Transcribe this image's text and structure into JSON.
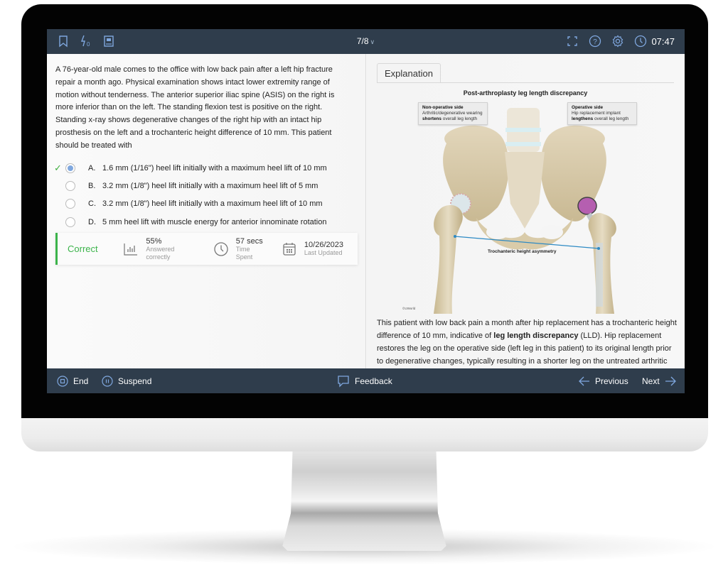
{
  "topbar": {
    "question_counter": "7/8",
    "timer": "07:47",
    "left_icons": [
      "bookmark-icon",
      "lab-values-icon",
      "notes-icon"
    ],
    "right_icons": [
      "fullscreen-icon",
      "help-icon",
      "settings-icon",
      "clock-icon"
    ]
  },
  "question": {
    "stem": "A 76-year-old male comes to the office with low back pain after a left hip fracture repair a month ago.  Physical examination shows intact lower extremity range of motion without tenderness.  The anterior superior iliac spine (ASIS) on the right is more inferior than on the left.  The standing flexion test is positive on the right.  Standing x-ray shows degenerative changes of the right hip with an intact hip prosthesis on the left and a trochanteric height difference of 10 mm.  This patient should be treated with",
    "options": [
      {
        "letter": "A.",
        "text": "1.6 mm (1/16\") heel lift initially with a maximum heel lift of 10 mm",
        "selected": true,
        "correct_mark": "✓"
      },
      {
        "letter": "B.",
        "text": "3.2 mm (1/8\") heel lift initially with a maximum heel lift of 5 mm",
        "selected": false,
        "correct_mark": ""
      },
      {
        "letter": "C.",
        "text": "3.2 mm (1/8\") heel lift initially with a maximum heel lift of 10 mm",
        "selected": false,
        "correct_mark": ""
      },
      {
        "letter": "D.",
        "text": "5 mm heel lift with muscle energy for anterior innominate rotation",
        "selected": false,
        "correct_mark": ""
      }
    ]
  },
  "stats": {
    "result": "Correct",
    "percent_value": "55%",
    "percent_label": "Answered correctly",
    "time_value": "57 secs",
    "time_label": "Time Spent",
    "date_value": "10/26/2023",
    "date_label": "Last Updated"
  },
  "explanation": {
    "tab_label": "Explanation",
    "figure": {
      "title": "Post-arthroplasty leg length discrepancy",
      "left_callout": {
        "heading": "Non-operative side",
        "line1": "Arthritic/degenerative wearing",
        "bold": "shortens",
        "rest": " overall leg length"
      },
      "right_callout": {
        "heading": "Operative side",
        "line1": "Hip replacement implant",
        "bold": "lengthens",
        "rest": " overall leg length"
      },
      "caption": "Trochanteric height asymmetry",
      "copyright": "©UWorld"
    },
    "text_before": "This patient with low back pain a month after hip replacement has a trochanteric height difference of 10 mm, indicative of ",
    "text_bold": "leg length discrepancy",
    "text_after": " (LLD).  Hip replacement restores the leg on the operative side (left leg in this patient) to its original length prior to degenerative changes, typically resulting in a shorter leg on the untreated arthritic"
  },
  "bottombar": {
    "end_label": "End",
    "suspend_label": "Suspend",
    "feedback_label": "Feedback",
    "previous_label": "Previous",
    "next_label": "Next"
  },
  "colors": {
    "bar_bg": "#2f3d4c",
    "icon_blue": "#7fa7de",
    "correct_green": "#3cb44b"
  }
}
